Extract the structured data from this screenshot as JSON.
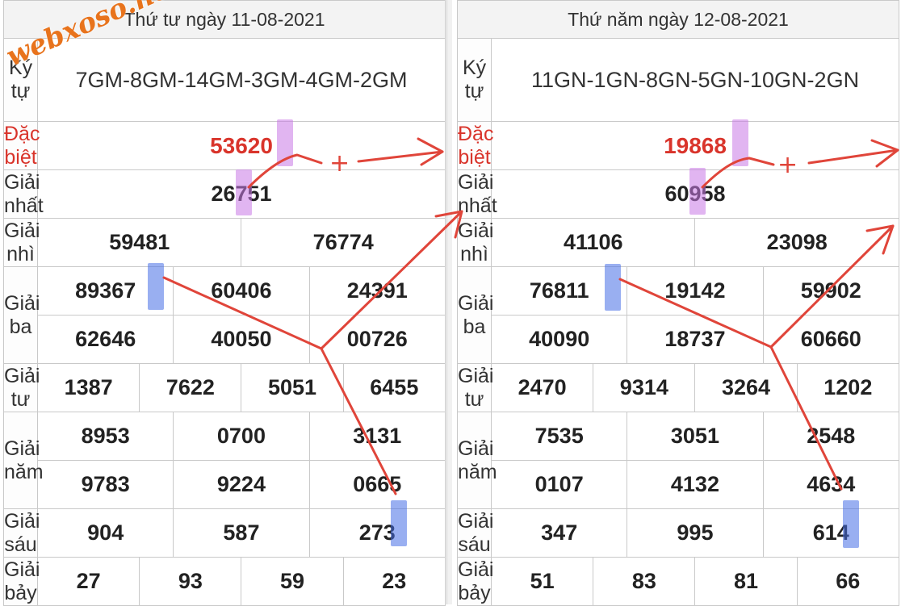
{
  "watermark": "webxoso.net",
  "labels": {
    "ky_tu": "Ký tự",
    "dac_biet": "Đặc biệt",
    "giai_nhat": "Giải nhất",
    "giai_nhi": "Giải nhì",
    "giai_ba": "Giải ba",
    "giai_tu": "Giải tư",
    "giai_nam": "Giải năm",
    "giai_sau": "Giải sáu",
    "giai_bay": "Giải bảy"
  },
  "left": {
    "header": "Thứ tư ngày 11-08-2021",
    "ky_tu": "7GM-8GM-14GM-3GM-4GM-2GM",
    "dac_biet": "53620",
    "giai_nhat": "26751",
    "giai_nhi": [
      "59481",
      "76774"
    ],
    "giai_ba": [
      "89367",
      "60406",
      "24391",
      "62646",
      "40050",
      "00726"
    ],
    "giai_tu": [
      "1387",
      "7622",
      "5051",
      "6455"
    ],
    "giai_nam": [
      "8953",
      "0700",
      "3131",
      "9783",
      "9224",
      "0665"
    ],
    "giai_sau": [
      "904",
      "587",
      "273"
    ],
    "giai_bay": [
      "27",
      "93",
      "59",
      "23"
    ]
  },
  "right": {
    "header": "Thứ năm ngày 12-08-2021",
    "ky_tu": "11GN-1GN-8GN-5GN-10GN-2GN",
    "dac_biet": "19868",
    "giai_nhat": "60958",
    "giai_nhi": [
      "41106",
      "23098"
    ],
    "giai_ba": [
      "76811",
      "19142",
      "59902",
      "40090",
      "18737",
      "60660"
    ],
    "giai_tu": [
      "2470",
      "9314",
      "3264",
      "1202"
    ],
    "giai_nam": [
      "7535",
      "3051",
      "2548",
      "0107",
      "4132",
      "4634"
    ],
    "giai_sau": [
      "347",
      "995",
      "614"
    ],
    "giai_bay": [
      "51",
      "83",
      "81",
      "66"
    ]
  },
  "annotation": {
    "plus_sign": "+",
    "stroke_color": "#e0453a",
    "highlight_purple": "#c878e6",
    "highlight_blue": "#466ee6"
  }
}
